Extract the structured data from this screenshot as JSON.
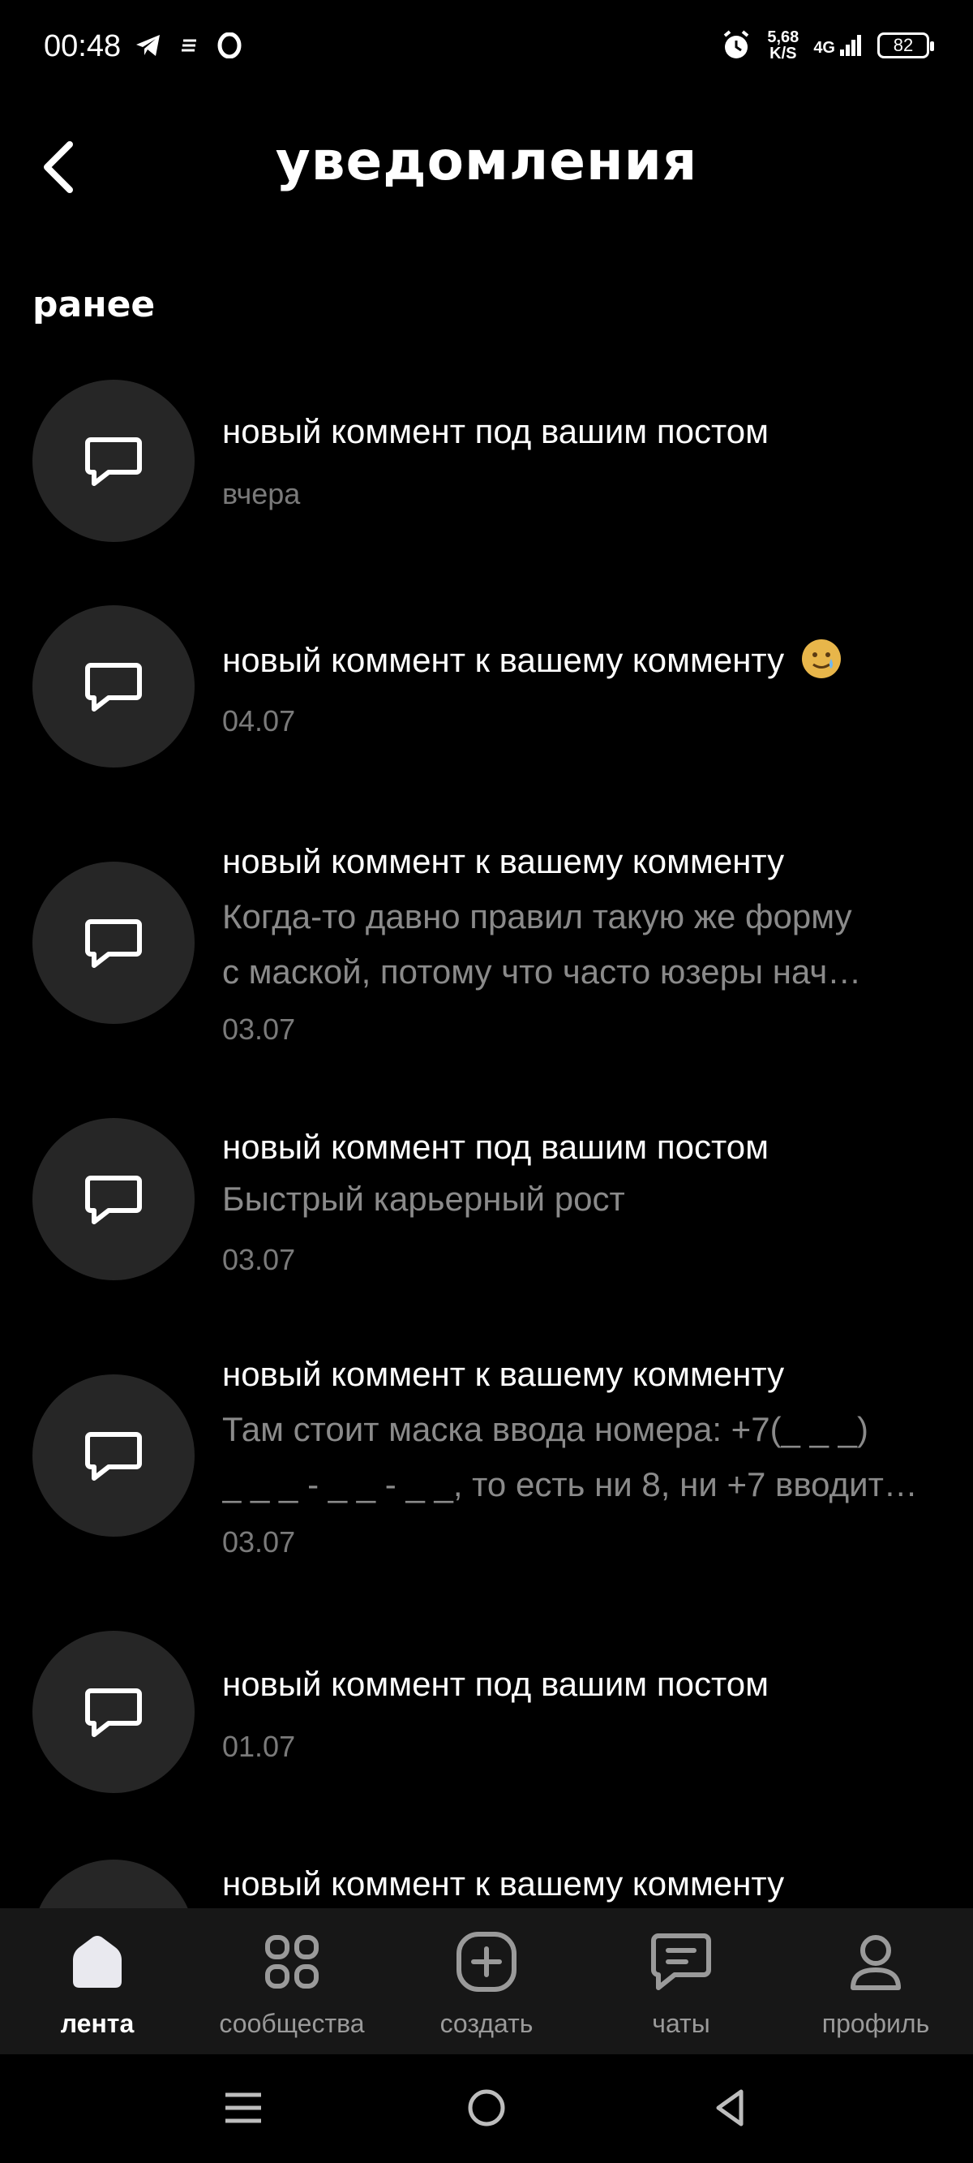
{
  "status_bar": {
    "time": "00:48",
    "net_speed_value": "5,68",
    "net_speed_unit": "K/S",
    "network": "4G",
    "battery": "82"
  },
  "header": {
    "title": "уведомления",
    "back_icon": "chevron-left-icon"
  },
  "section_label": "ранее",
  "notifications": [
    {
      "title": "новый коммент под вашим постом",
      "body": [],
      "date": "вчера",
      "icon": "comment-icon"
    },
    {
      "title": "новый коммент к вашему комменту",
      "emoji": "🥲",
      "body": [],
      "date": "04.07",
      "icon": "comment-icon"
    },
    {
      "title": "новый коммент к вашему комменту",
      "body": [
        "Когда-то давно правил такую же форму",
        "с маской, потому что часто юзеры нач…"
      ],
      "date": "03.07",
      "icon": "comment-icon"
    },
    {
      "title": "новый коммент под вашим постом",
      "body": [
        "Быстрый карьерный рост"
      ],
      "date": "03.07",
      "icon": "comment-icon"
    },
    {
      "title": "новый коммент к вашему комменту",
      "body": [
        "Там стоит маска ввода номера: +7(_ _ _)",
        "_ _ _ - _ _ - _ _, то есть ни 8, ни +7 вводит…"
      ],
      "date": "03.07",
      "icon": "comment-icon"
    },
    {
      "title": "новый коммент под вашим постом",
      "body": [],
      "date": "01.07",
      "icon": "comment-icon"
    },
    {
      "title": "новый коммент к вашему комменту",
      "body": [],
      "date": "",
      "icon": "comment-icon"
    }
  ],
  "bottom_nav": [
    {
      "label": "лента",
      "icon": "home-icon",
      "active": true
    },
    {
      "label": "сообщества",
      "icon": "grid-icon",
      "active": false
    },
    {
      "label": "создать",
      "icon": "plus-square-icon",
      "active": false
    },
    {
      "label": "чаты",
      "icon": "chat-icon",
      "active": false
    },
    {
      "label": "профиль",
      "icon": "person-icon",
      "active": false
    }
  ],
  "colors": {
    "background": "#000000",
    "avatar_bg": "#262626",
    "nav_bg": "#171717",
    "secondary_text": "#8a8a8a"
  }
}
